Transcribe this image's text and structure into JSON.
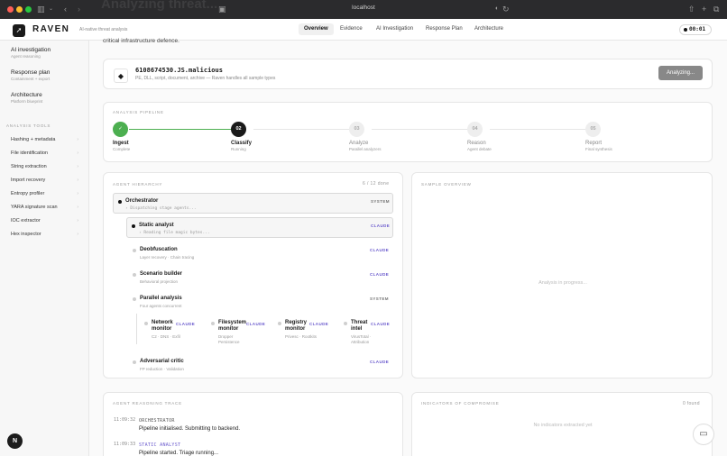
{
  "browser": {
    "url": "localhost",
    "ghost_title": "Analyzing threat..."
  },
  "app": {
    "brand": "RAVEN",
    "tagline": "AI-native threat analysis"
  },
  "nav": {
    "tabs": [
      "Overview",
      "Evidence",
      "AI Investigation",
      "Response Plan",
      "Architecture"
    ],
    "active": "Overview"
  },
  "timer": {
    "value": "00:01"
  },
  "sidebar": {
    "items": [
      {
        "title": "AI investigation",
        "sub": "Agent reasoning"
      },
      {
        "title": "Response plan",
        "sub": "Containment + export"
      },
      {
        "title": "Architecture",
        "sub": "Platform blueprint"
      }
    ],
    "section_label": "ANALYSIS TOOLS",
    "tools": [
      "Hashing + metadata",
      "File identification",
      "String extraction",
      "Import recovery",
      "Entropy profiler",
      "YARA signature scan",
      "IOC extractor",
      "Hex inspector"
    ],
    "avatar": "N"
  },
  "main": {
    "cutoff_text": "critical infrastructure defence."
  },
  "sample": {
    "filename": "6108674530.JS.malicious",
    "subtitle": "PE, DLL, script, document, archive — Raven handles all sample types",
    "button": "Analyzing..."
  },
  "pipeline": {
    "label": "ANALYSIS PIPELINE",
    "stages": [
      {
        "num": "✓",
        "name": "Ingest",
        "status": "Complete",
        "state": "done"
      },
      {
        "num": "02",
        "name": "Classify",
        "status": "Running",
        "state": "active"
      },
      {
        "num": "03",
        "name": "Analyze",
        "status": "Parallel analyzers",
        "state": "pending"
      },
      {
        "num": "04",
        "name": "Reason",
        "status": "Agent debate",
        "state": "pending"
      },
      {
        "num": "05",
        "name": "Report",
        "status": "Final synthesis",
        "state": "pending"
      }
    ]
  },
  "hierarchy": {
    "label": "AGENT HIERARCHY",
    "count": "6 / 12 done",
    "orchestrator": {
      "name": "Orchestrator",
      "sub": "› Dispatching stage agents...",
      "tag": "SYSTEM"
    },
    "static": {
      "name": "Static analyst",
      "sub": "› Reading file magic bytes...",
      "tag": "CLAUDE"
    },
    "deobfuscation": {
      "name": "Deobfuscation",
      "sub": "Layer recovery · Chain tracing",
      "tag": "CLAUDE"
    },
    "scenario": {
      "name": "Scenario builder",
      "sub": "Behavioral projection",
      "tag": "CLAUDE"
    },
    "parallel": {
      "name": "Parallel analysis",
      "sub": "Four agents concurrent",
      "tag": "SYSTEM"
    },
    "monitors": [
      {
        "name": "Network monitor",
        "sub": "C2 · DNS · Exfil",
        "tag": "CLAUDE"
      },
      {
        "name": "Filesystem monitor",
        "sub": "Dropper Persistence",
        "tag": "CLAUDE"
      },
      {
        "name": "Registry monitor",
        "sub": "Privesc · Rootkits",
        "tag": "CLAUDE"
      },
      {
        "name": "Threat intel",
        "sub": "VirusTotal · Attribution",
        "tag": "CLAUDE"
      }
    ],
    "critic": {
      "name": "Adversarial critic",
      "sub": "FP reduction · Validation",
      "tag": "CLAUDE"
    }
  },
  "overview": {
    "label": "SAMPLE OVERVIEW",
    "placeholder": "Analysis in progress..."
  },
  "trace": {
    "label": "AGENT REASONING TRACE",
    "entries": [
      {
        "time": "11:09:32",
        "role": "ORCHESTRATOR",
        "msg": "Pipeline initialised. Submitting to backend.",
        "color": "#555555"
      },
      {
        "time": "11:09:33",
        "role": "STATIC ANALYST",
        "msg": "Pipeline started. Triage running...",
        "color": "#6a5acd"
      }
    ]
  },
  "ioc": {
    "label": "INDICATORS OF COMPROMISE",
    "count": "0 found",
    "placeholder": "No indicators extracted yet"
  },
  "colors": {
    "accent": "#6a5acd",
    "done": "#4caf50"
  }
}
